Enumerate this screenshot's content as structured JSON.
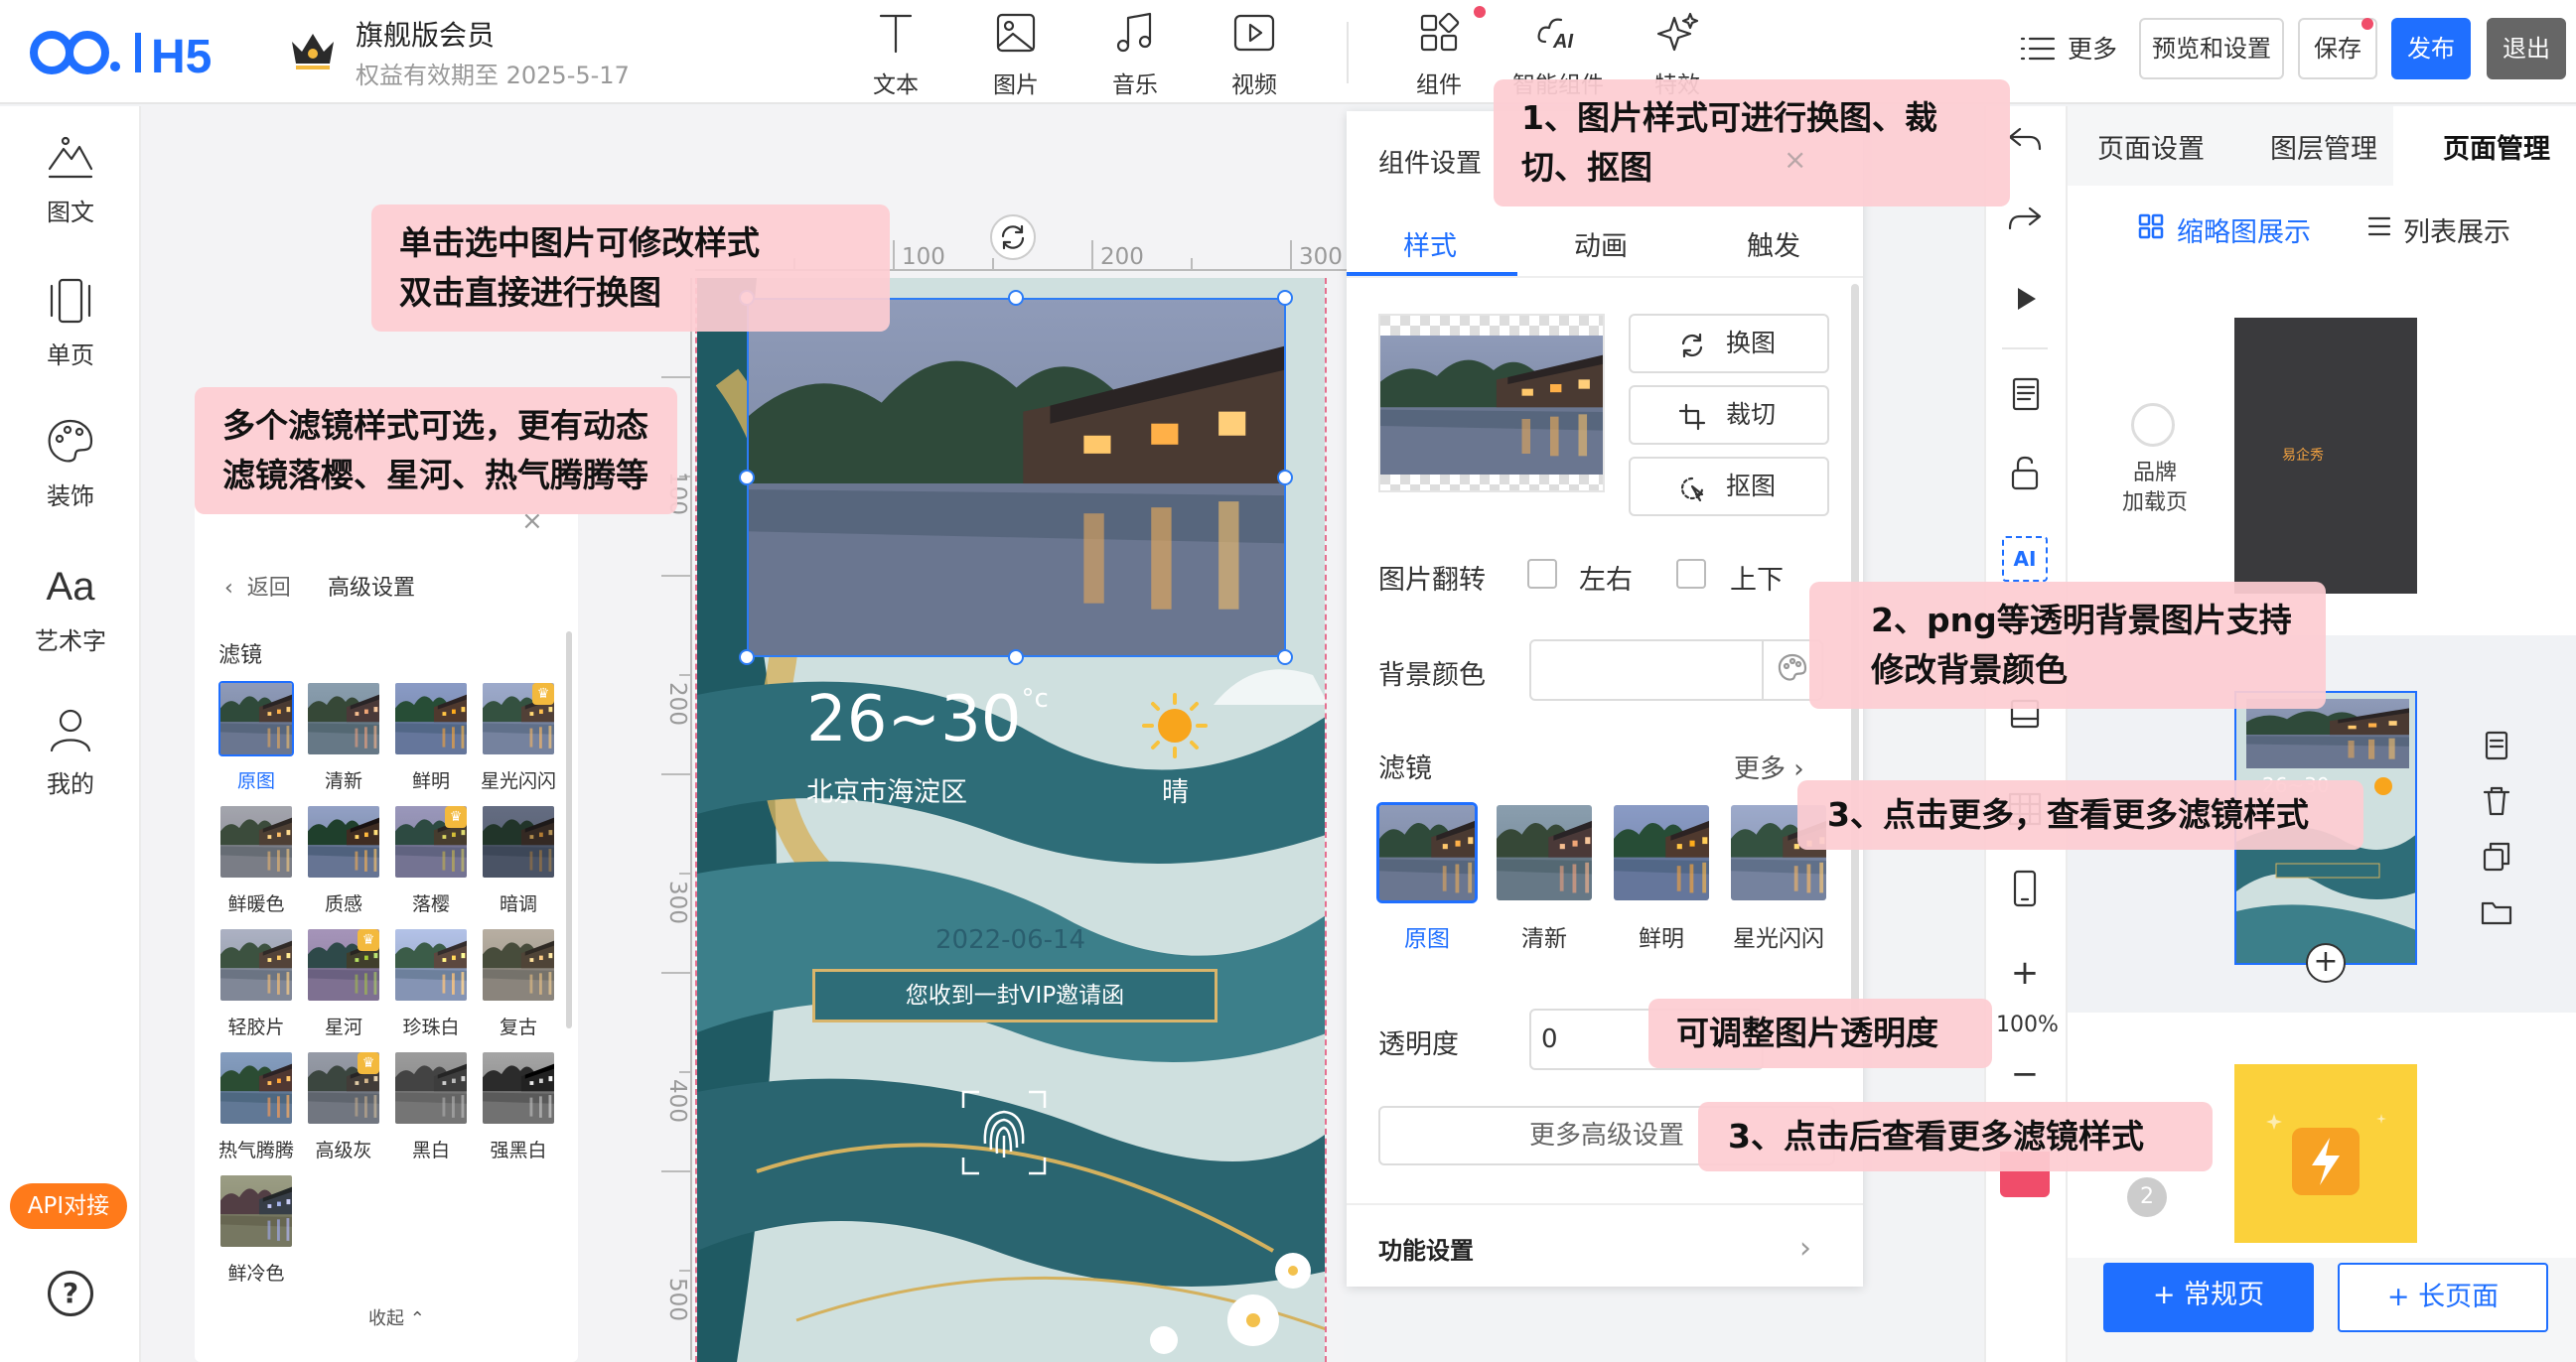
{
  "app": {
    "logo_text": "H5"
  },
  "vip": {
    "title": "旗舰版会员",
    "expiry": "权益有效期至 2025-5-17"
  },
  "toolbar": [
    {
      "icon": "text-icon",
      "label": "文本"
    },
    {
      "icon": "image-icon",
      "label": "图片"
    },
    {
      "icon": "music-icon",
      "label": "音乐"
    },
    {
      "icon": "video-icon",
      "label": "视频"
    },
    {
      "icon": "component-icon",
      "label": "组件"
    },
    {
      "icon": "ai-component-icon",
      "label": "智能组件"
    },
    {
      "icon": "effects-icon",
      "label": "特效"
    }
  ],
  "header_right": {
    "more": "更多",
    "preview": "预览和设置",
    "save": "保存",
    "publish": "发布",
    "exit": "退出"
  },
  "leftnav": [
    {
      "icon": "image-text-icon",
      "label": "图文"
    },
    {
      "icon": "single-page-icon",
      "label": "单页"
    },
    {
      "icon": "palette-icon",
      "label": "装饰"
    },
    {
      "icon": "art-text-icon",
      "label": "艺术字",
      "glyph": "Aa"
    },
    {
      "icon": "user-icon",
      "label": "我的"
    }
  ],
  "api_badge": "API对接",
  "help_glyph": "?",
  "filter_panel": {
    "back": "返回",
    "advanced": "高级设置",
    "title": "滤镜",
    "close": "×",
    "collapse": "收起",
    "filters": [
      {
        "label": "原图",
        "selected": true,
        "premium": false
      },
      {
        "label": "清新",
        "selected": false,
        "premium": false
      },
      {
        "label": "鲜明",
        "selected": false,
        "premium": false
      },
      {
        "label": "星光闪闪",
        "selected": false,
        "premium": true
      },
      {
        "label": "鲜暖色",
        "selected": false,
        "premium": false
      },
      {
        "label": "质感",
        "selected": false,
        "premium": false
      },
      {
        "label": "落樱",
        "selected": false,
        "premium": true
      },
      {
        "label": "暗调",
        "selected": false,
        "premium": false
      },
      {
        "label": "轻胶片",
        "selected": false,
        "premium": false
      },
      {
        "label": "星河",
        "selected": false,
        "premium": true
      },
      {
        "label": "珍珠白",
        "selected": false,
        "premium": false
      },
      {
        "label": "复古",
        "selected": false,
        "premium": false
      },
      {
        "label": "热气腾腾",
        "selected": false,
        "premium": false
      },
      {
        "label": "高级灰",
        "selected": false,
        "premium": true
      },
      {
        "label": "黑白",
        "selected": false,
        "premium": false
      },
      {
        "label": "强黑白",
        "selected": false,
        "premium": false
      },
      {
        "label": "鲜冷色",
        "selected": false,
        "premium": false
      }
    ]
  },
  "ruler": {
    "top": [
      "100",
      "200",
      "300"
    ],
    "left": [
      "100",
      "200",
      "300",
      "400",
      "500"
    ]
  },
  "phone": {
    "temp": "26~30",
    "temp_unit": "°c",
    "city": "北京市海淀区",
    "weather": "晴",
    "date": "2022-06-14",
    "invite": "您收到一封VIP邀请函"
  },
  "props": {
    "title": "组件设置",
    "tabs": [
      "样式",
      "动画",
      "触发"
    ],
    "buttons": [
      {
        "icon": "swap-icon",
        "label": "换图"
      },
      {
        "icon": "crop-icon",
        "label": "裁切"
      },
      {
        "icon": "cutout-icon",
        "label": "抠图"
      }
    ],
    "flip_label": "图片翻转",
    "flip_lr": "左右",
    "flip_ud": "上下",
    "bgcolor_label": "背景颜色",
    "filter_label": "滤镜",
    "filter_more": "更多",
    "filters": [
      {
        "label": "原图",
        "selected": true
      },
      {
        "label": "清新",
        "selected": false
      },
      {
        "label": "鲜明",
        "selected": false
      },
      {
        "label": "星光闪闪",
        "selected": false
      }
    ],
    "opacity_label": "透明度",
    "opacity_value": "0",
    "advanced": "更多高级设置",
    "function": "功能设置"
  },
  "vtools": {
    "zoom": "100%",
    "ai_label": "AI",
    "plus": "+",
    "minus": "−"
  },
  "right_panel": {
    "tabs": [
      "页面设置",
      "图层管理",
      "页面管理"
    ],
    "active_tab": "页面管理",
    "view_thumb": "缩略图展示",
    "view_list": "列表展示",
    "brand_loading": "品牌\n加载页",
    "page_number": "2",
    "page1_brand": "易企秀",
    "page2_temp": "26~30",
    "add_normal": "+ 常规页",
    "add_long": "+ 长页面"
  },
  "callouts": {
    "c1": "1、图片样式可进行换图、裁切、抠图",
    "c2": "2、png等透明背景图片支持修改背景颜色",
    "c3": "3、点击更多，查看更多滤镜样式",
    "c4": "3、点击后查看更多滤镜样式",
    "c5": "可调整图片透明度",
    "c6": "单击选中图片可修改样式\n双击直接进行换图",
    "c7": "多个滤镜样式可选，更有动态滤镜落樱、星河、热气腾腾等"
  },
  "colors": {
    "primary": "#1f6fff",
    "accent": "#f04d6a",
    "callout": "#fdccd2",
    "api": "#ff7a1a"
  }
}
